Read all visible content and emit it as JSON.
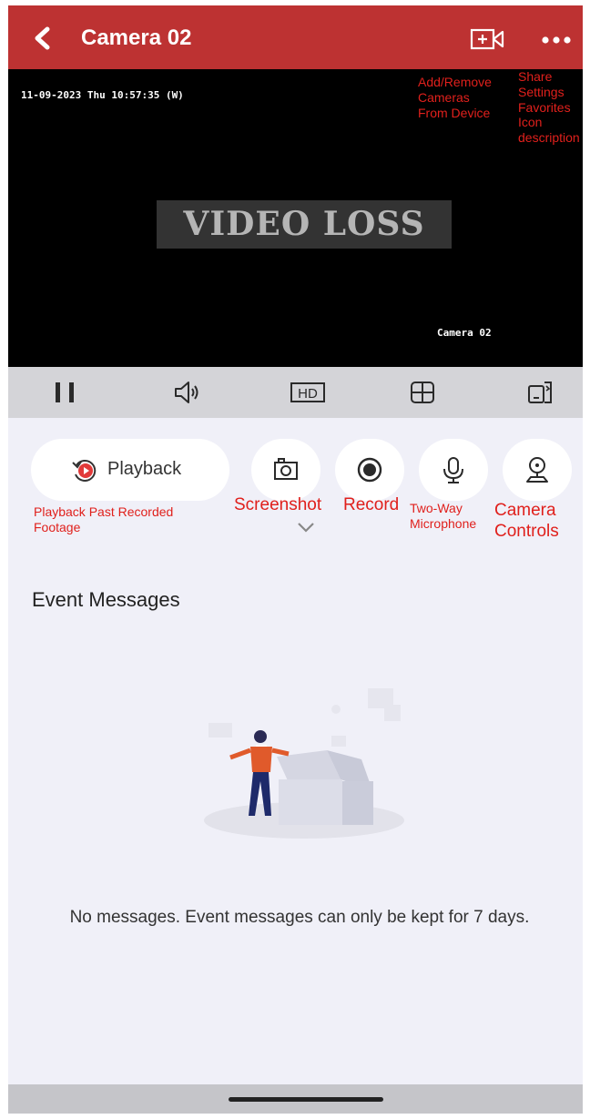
{
  "header": {
    "title": "Camera 02",
    "back_icon": "back-chevron-icon",
    "add_camera_icon": "add-camera-icon",
    "more_icon": "more-dots-icon",
    "bg_color": "#bd3232"
  },
  "video": {
    "timestamp": "11-09-2023 Thu 10:57:35 (W)",
    "status": "VIDEO LOSS",
    "camera_label": "Camera 02"
  },
  "annotations": {
    "add_remove": "Add/Remove\nCameras\nFrom Device",
    "more_menu": "Share\nSettings\nFavorites\nIcon\ndescription",
    "playback": "Playback Past Recorded\nFootage",
    "screenshot": "Screenshot",
    "record": "Record",
    "two_way": "Two-Way\nMicrophone",
    "camera_controls": "Camera\nControls",
    "color": "#e0201c"
  },
  "controls": [
    {
      "name": "pause",
      "icon": "pause-icon"
    },
    {
      "name": "sound",
      "icon": "speaker-icon"
    },
    {
      "name": "hd",
      "icon": "hd-icon",
      "label": "HD"
    },
    {
      "name": "layout",
      "icon": "grid-icon"
    },
    {
      "name": "rotate",
      "icon": "rotate-screen-icon"
    }
  ],
  "actions": {
    "playback_label": "Playback",
    "screenshot_icon": "camera-icon",
    "record_icon": "record-icon",
    "mic_icon": "microphone-icon",
    "ptz_icon": "camera-controls-icon",
    "expand_icon": "chevron-down-icon"
  },
  "events": {
    "title": "Event Messages",
    "empty_message": "No messages. Event messages can only be kept for 7 days."
  }
}
